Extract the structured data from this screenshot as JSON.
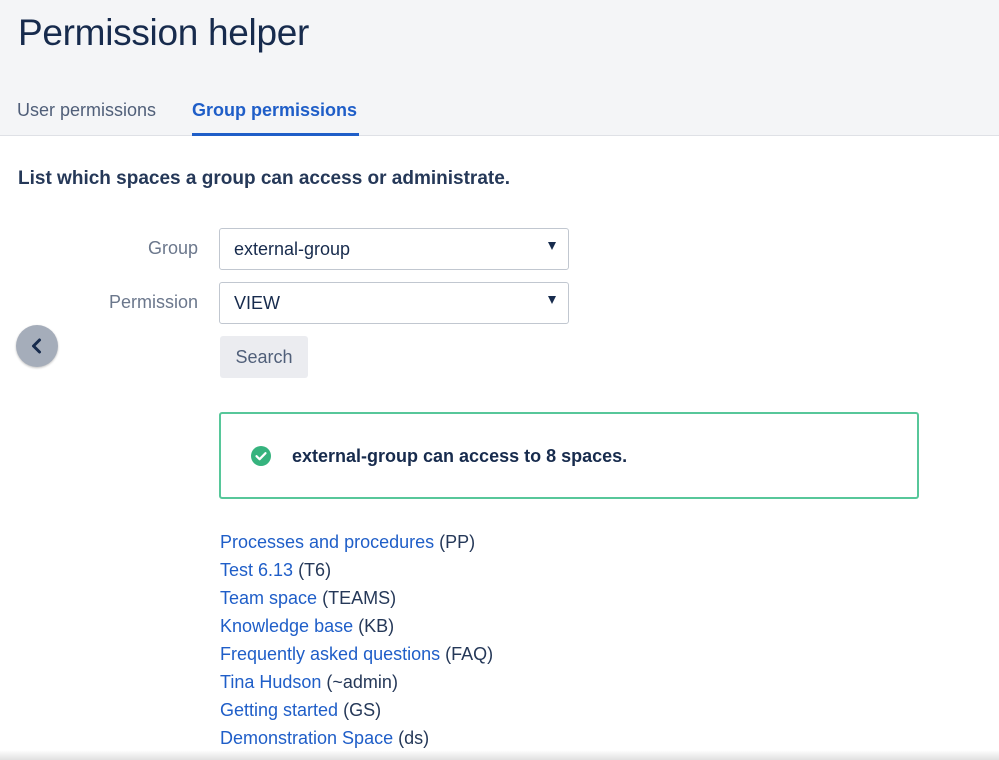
{
  "header": {
    "title": "Permission helper",
    "tabs": [
      {
        "label": "User permissions",
        "active": false
      },
      {
        "label": "Group permissions",
        "active": true
      }
    ]
  },
  "main": {
    "description": "List which spaces a group can access or administrate.",
    "form": {
      "group_label": "Group",
      "group_value": "external-group",
      "permission_label": "Permission",
      "permission_value": "VIEW",
      "search_label": "Search"
    },
    "result": {
      "message": "external-group can access to 8 spaces.",
      "status_color": "#36b37e"
    },
    "spaces": [
      {
        "name": "Processes and procedures",
        "key": "(PP)"
      },
      {
        "name": "Test 6.13",
        "key": "(T6)"
      },
      {
        "name": "Team space",
        "key": "(TEAMS)"
      },
      {
        "name": "Knowledge base",
        "key": "(KB)"
      },
      {
        "name": "Frequently asked questions",
        "key": "(FAQ)"
      },
      {
        "name": "Tina Hudson",
        "key": "(~admin)"
      },
      {
        "name": "Getting started",
        "key": "(GS)"
      },
      {
        "name": "Demonstration Space",
        "key": "(ds)"
      }
    ]
  },
  "icons": {
    "collapse": "chevron-left-icon",
    "success": "check-circle-icon",
    "dropdown": "caret-down-icon"
  },
  "colors": {
    "link": "#1f5ec8",
    "active_tab": "#1f5ec8",
    "success_border": "#57c79a"
  }
}
